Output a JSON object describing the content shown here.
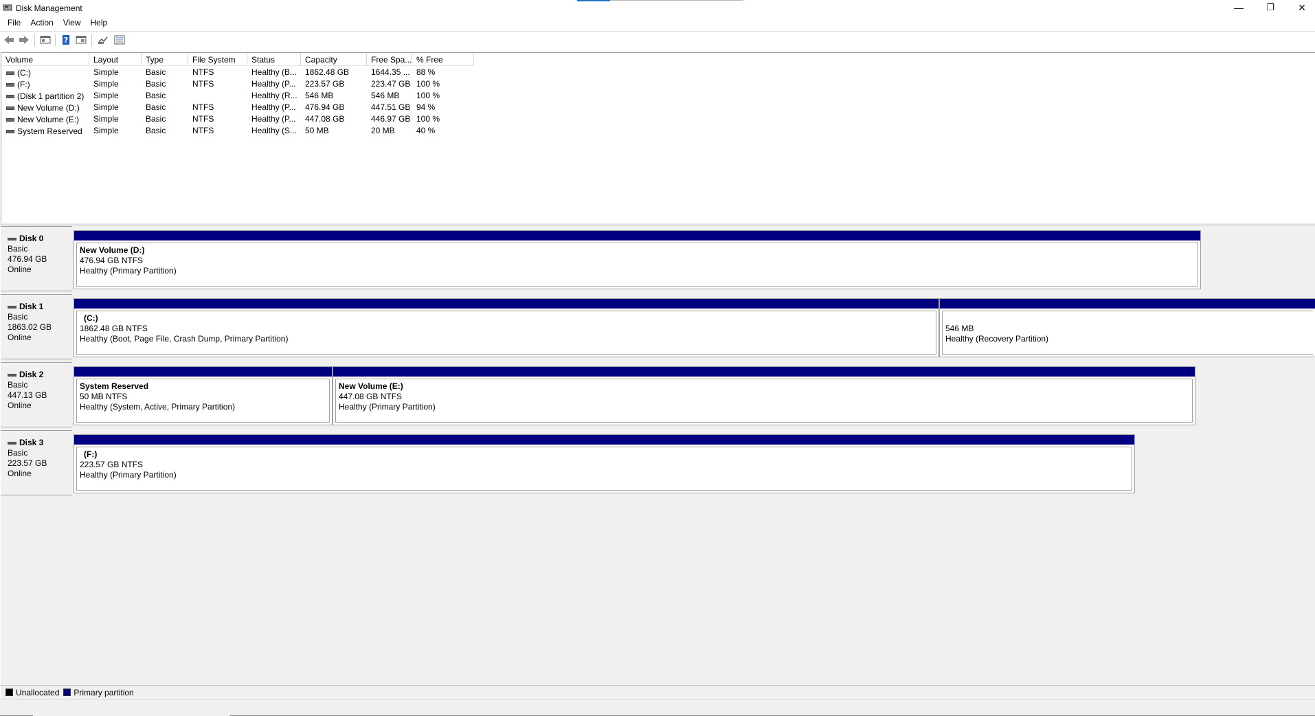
{
  "window": {
    "title": "Disk Management",
    "controls": {
      "minimize": "—",
      "restore": "❐",
      "close": "✕"
    }
  },
  "menu": [
    "File",
    "Action",
    "View",
    "Help"
  ],
  "toolbar": {
    "icons": [
      "back-arrow-icon",
      "forward-arrow-icon",
      "console-tree-icon",
      "help-icon",
      "properties-icon",
      "rescan-icon",
      "list-view-icon"
    ]
  },
  "volume_list": {
    "columns": [
      "Volume",
      "Layout",
      "Type",
      "File System",
      "Status",
      "Capacity",
      "Free Spa...",
      "% Free"
    ],
    "rows": [
      [
        "(C:)",
        "Simple",
        "Basic",
        "NTFS",
        "Healthy (B...",
        "1862.48 GB",
        "1644.35 ...",
        "88 %"
      ],
      [
        "(F:)",
        "Simple",
        "Basic",
        "NTFS",
        "Healthy (P...",
        "223.57 GB",
        "223.47 GB",
        "100 %"
      ],
      [
        "(Disk 1 partition 2)",
        "Simple",
        "Basic",
        "",
        "Healthy (R...",
        "546 MB",
        "546 MB",
        "100 %"
      ],
      [
        "New Volume (D:)",
        "Simple",
        "Basic",
        "NTFS",
        "Healthy (P...",
        "476.94 GB",
        "447.51 GB",
        "94 %"
      ],
      [
        "New Volume (E:)",
        "Simple",
        "Basic",
        "NTFS",
        "Healthy (P...",
        "447.08 GB",
        "446.97 GB",
        "100 %"
      ],
      [
        "System Reserved",
        "Simple",
        "Basic",
        "NTFS",
        "Healthy (S...",
        "50 MB",
        "20 MB",
        "40 %"
      ]
    ]
  },
  "disks": [
    {
      "name": "Disk 0",
      "type": "Basic",
      "size": "476.94 GB",
      "state": "Online",
      "partitions": [
        {
          "name": "New Volume  (D:)",
          "size": "476.94 GB NTFS",
          "status": "Healthy (Primary Partition)"
        }
      ]
    },
    {
      "name": "Disk 1",
      "type": "Basic",
      "size": "1863.02 GB",
      "state": "Online",
      "partitions": [
        {
          "name": "(C:)",
          "size": "1862.48 GB NTFS",
          "status": "Healthy (Boot, Page File, Crash Dump, Primary Partition)"
        },
        {
          "name": "",
          "size": "546 MB",
          "status": "Healthy (Recovery Partition)"
        }
      ]
    },
    {
      "name": "Disk 2",
      "type": "Basic",
      "size": "447.13 GB",
      "state": "Online",
      "partitions": [
        {
          "name": "System Reserved",
          "size": "50 MB NTFS",
          "status": "Healthy (System, Active, Primary Partition)"
        },
        {
          "name": "New Volume  (E:)",
          "size": "447.08 GB NTFS",
          "status": "Healthy (Primary Partition)"
        }
      ]
    },
    {
      "name": "Disk 3",
      "type": "Basic",
      "size": "223.57 GB",
      "state": "Online",
      "partitions": [
        {
          "name": "(F:)",
          "size": "223.57 GB NTFS",
          "status": "Healthy (Primary Partition)"
        }
      ]
    }
  ],
  "legend": [
    {
      "label": "Unallocated",
      "color": "#000000"
    },
    {
      "label": "Primary partition",
      "color": "#000080"
    }
  ]
}
